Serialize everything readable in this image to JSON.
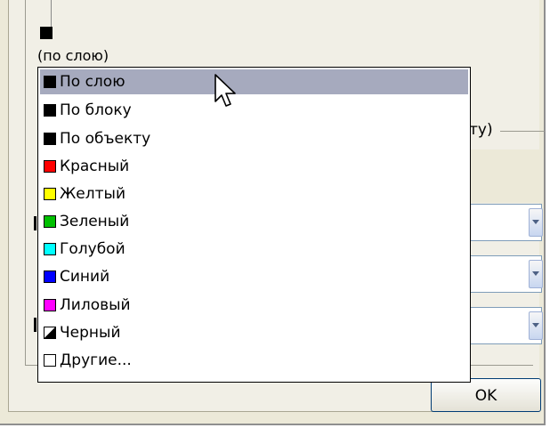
{
  "background_label": "(по слою)",
  "partial_text": "ту)",
  "ok_button": "OK",
  "dropdown": {
    "items": [
      {
        "label": "По слою",
        "color": "#000000",
        "selected": true
      },
      {
        "label": "По блоку",
        "color": "#000000"
      },
      {
        "label": "По объекту",
        "color": "#000000"
      },
      {
        "label": "Красный",
        "color": "#ff0000"
      },
      {
        "label": "Желтый",
        "color": "#ffff00"
      },
      {
        "label": "Зеленый",
        "color": "#00c000"
      },
      {
        "label": "Голубой",
        "color": "#00ffff"
      },
      {
        "label": "Синий",
        "color": "#0000ff"
      },
      {
        "label": "Лиловый",
        "color": "#ff00ff"
      },
      {
        "label": "Черный",
        "color": "black/white"
      },
      {
        "label": "Другие...",
        "color": "#ffffff"
      }
    ]
  },
  "colors": {
    "selection": "#a6aabe",
    "dialog_bg": "#ece9d8"
  },
  "icons": {
    "cursor": "mouse-pointer-icon"
  }
}
